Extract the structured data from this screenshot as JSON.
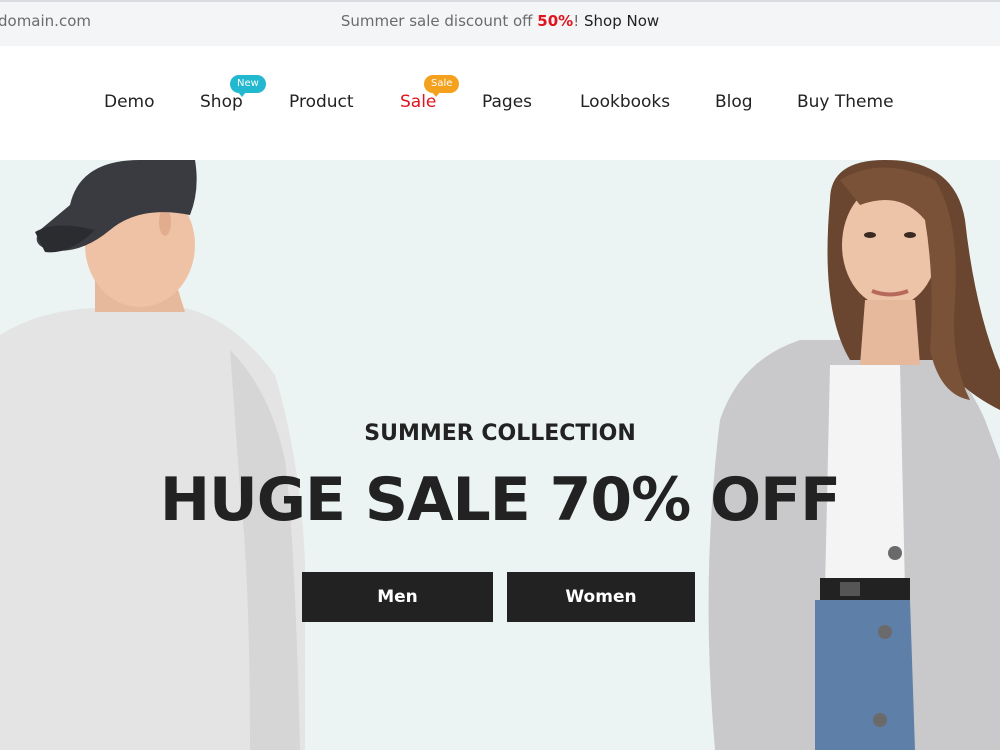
{
  "topbar": {
    "domain": "domain.com",
    "promo_prefix": "Summer sale discount off ",
    "promo_percent": "50%",
    "promo_bang": "! ",
    "promo_link": "Shop Now"
  },
  "nav": {
    "items": [
      {
        "label": "Demo"
      },
      {
        "label": "Shop",
        "badge": "New"
      },
      {
        "label": "Product"
      },
      {
        "label": "Sale",
        "badge": "Sale"
      },
      {
        "label": "Pages"
      },
      {
        "label": "Lookbooks"
      },
      {
        "label": "Blog"
      },
      {
        "label": "Buy Theme"
      }
    ]
  },
  "hero": {
    "eyebrow": "SUMMER COLLECTION",
    "headline": "HUGE SALE 70% OFF",
    "buttons": {
      "men": "Men",
      "women": "Women"
    }
  },
  "colors": {
    "accent_red": "#e0141e",
    "badge_new": "#22b8cf",
    "badge_sale": "#f4a11d",
    "hero_bg": "#ecf3f3",
    "button_bg": "#222222"
  }
}
